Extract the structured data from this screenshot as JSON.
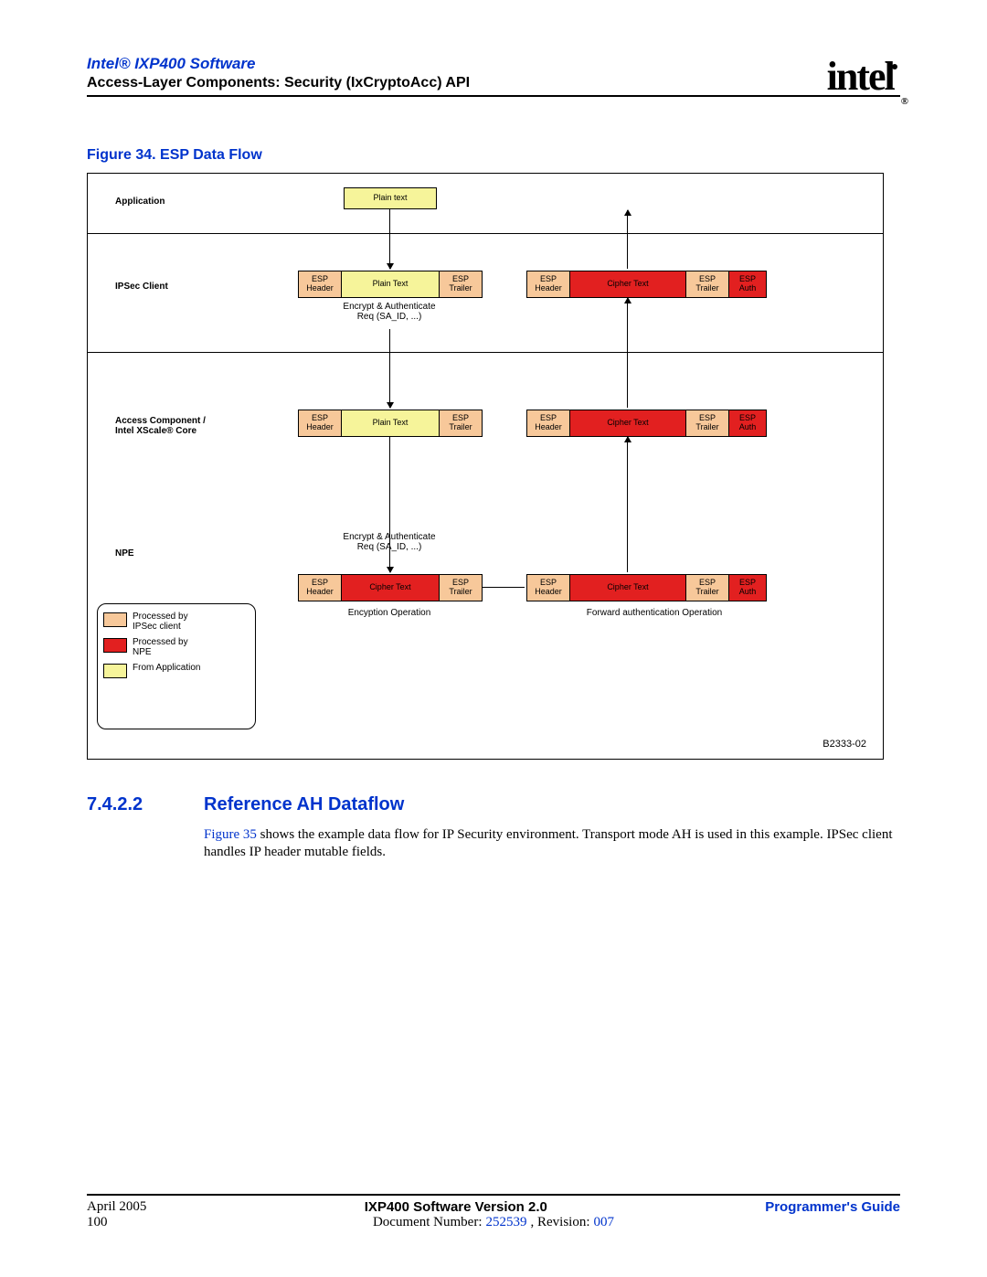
{
  "header": {
    "title": "Intel® IXP400 Software",
    "subtitle": "Access-Layer Components: Security (IxCryptoAcc) API",
    "logo_text": "intel",
    "logo_reg": "®"
  },
  "figure": {
    "title": "Figure 34. ESP Data Flow",
    "diagram_id": "B2333-02",
    "rows": {
      "application": "Application",
      "ipsec": "IPSec Client",
      "access": "Access Component /\nIntel XScale® Core",
      "npe": "NPE"
    },
    "blocks": {
      "plain_text_top": "Plain text",
      "esp_header": "ESP\nHeader",
      "plain_text": "Plain Text",
      "esp_trailer": "ESP\nTrailer",
      "cipher_text": "Cipher Text",
      "esp_auth": "ESP\nAuth"
    },
    "annot": {
      "enc_auth_req": "Encrypt & Authenticate\nReq (SA_ID, ...)",
      "encryption_op": "Encyption Operation",
      "forward_auth_op": "Forward authentication Operation"
    },
    "legend": {
      "ipsec": "Processed by\nIPSec client",
      "npe": "Processed by\nNPE",
      "app": "From  Application"
    }
  },
  "section": {
    "number": "7.4.2.2",
    "title": "Reference AH Dataflow",
    "para_link": "Figure 35",
    "para_rest": " shows the example data flow for IP Security environment. Transport mode AH is used in this example. IPSec client handles IP header mutable fields."
  },
  "footer": {
    "date": "April 2005",
    "page": "100",
    "center": "IXP400 Software Version 2.0",
    "right": "Programmer's Guide",
    "doc_label": "Document Number: ",
    "doc_num": "252539",
    "rev_label": ", Revision: ",
    "rev_num": "007"
  }
}
